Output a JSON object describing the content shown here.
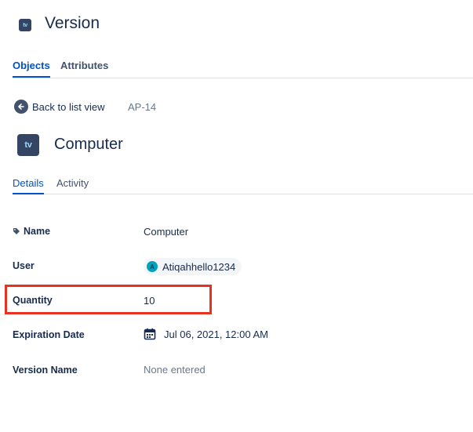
{
  "header": {
    "title": "Version",
    "icon": "apple-tv-icon",
    "icon_text": "tv"
  },
  "top_tabs": [
    {
      "label": "Objects",
      "active": true
    },
    {
      "label": "Attributes",
      "active": false
    }
  ],
  "nav": {
    "back_label": "Back to list view",
    "object_key": "AP-14"
  },
  "object": {
    "title": "Computer",
    "icon": "apple-tv-icon",
    "icon_text": "tv"
  },
  "detail_tabs": [
    {
      "label": "Details",
      "active": true
    },
    {
      "label": "Activity",
      "active": false
    }
  ],
  "fields": {
    "name": {
      "label": "Name",
      "value": "Computer"
    },
    "user": {
      "label": "User",
      "value": "Atiqahhello1234",
      "avatar_initial": "A"
    },
    "quantity": {
      "label": "Quantity",
      "value": "10"
    },
    "expiration": {
      "label": "Expiration Date",
      "value": "Jul 06, 2021, 12:00 AM"
    },
    "version_name": {
      "label": "Version Name",
      "value": "None entered"
    }
  },
  "colors": {
    "accent": "#0052cc",
    "highlight": "#e63220",
    "text": "#172b4d",
    "muted": "#6b778c"
  }
}
